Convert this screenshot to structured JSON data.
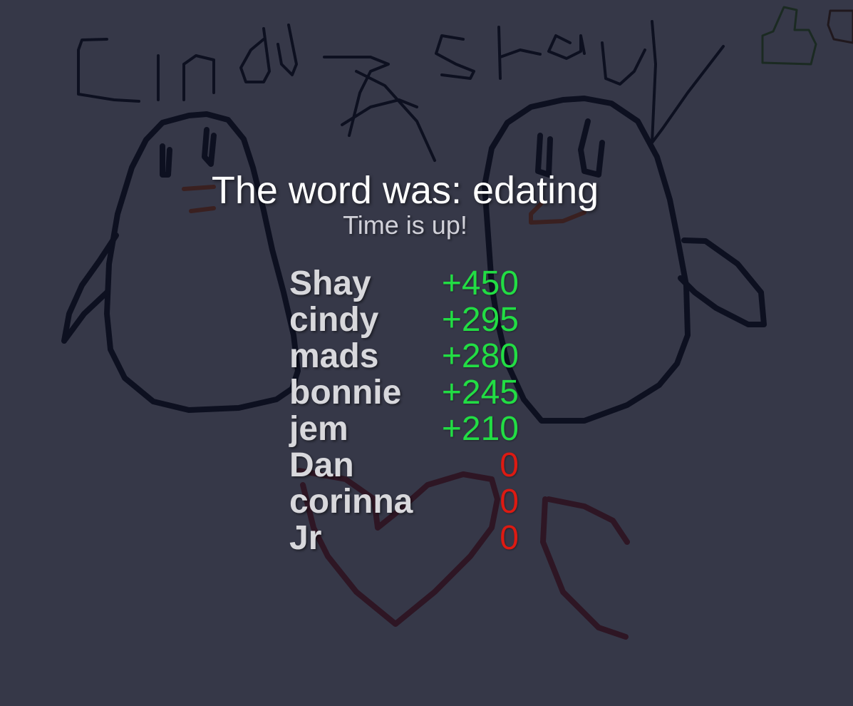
{
  "reveal": {
    "title": "The word was: edating",
    "subtitle": "Time is up!"
  },
  "scores": [
    {
      "name": "Shay",
      "points": "+450",
      "positive": true
    },
    {
      "name": "cindy",
      "points": "+295",
      "positive": true
    },
    {
      "name": "mads",
      "points": "+280",
      "positive": true
    },
    {
      "name": "bonnie",
      "points": "+245",
      "positive": true
    },
    {
      "name": "jem",
      "points": "+210",
      "positive": true
    },
    {
      "name": "Dan",
      "points": "0",
      "positive": false
    },
    {
      "name": "corinna",
      "points": "0",
      "positive": false
    },
    {
      "name": "Jr",
      "points": "0",
      "positive": false
    }
  ],
  "colors": {
    "background": "#363848",
    "positive_points": "#22dd44",
    "zero_points": "#dd1a12",
    "ink_dark": "#0d1020",
    "ink_brown": "#3a2020",
    "ink_heart": "#2e1624",
    "thumb_icon": "#23402e"
  }
}
